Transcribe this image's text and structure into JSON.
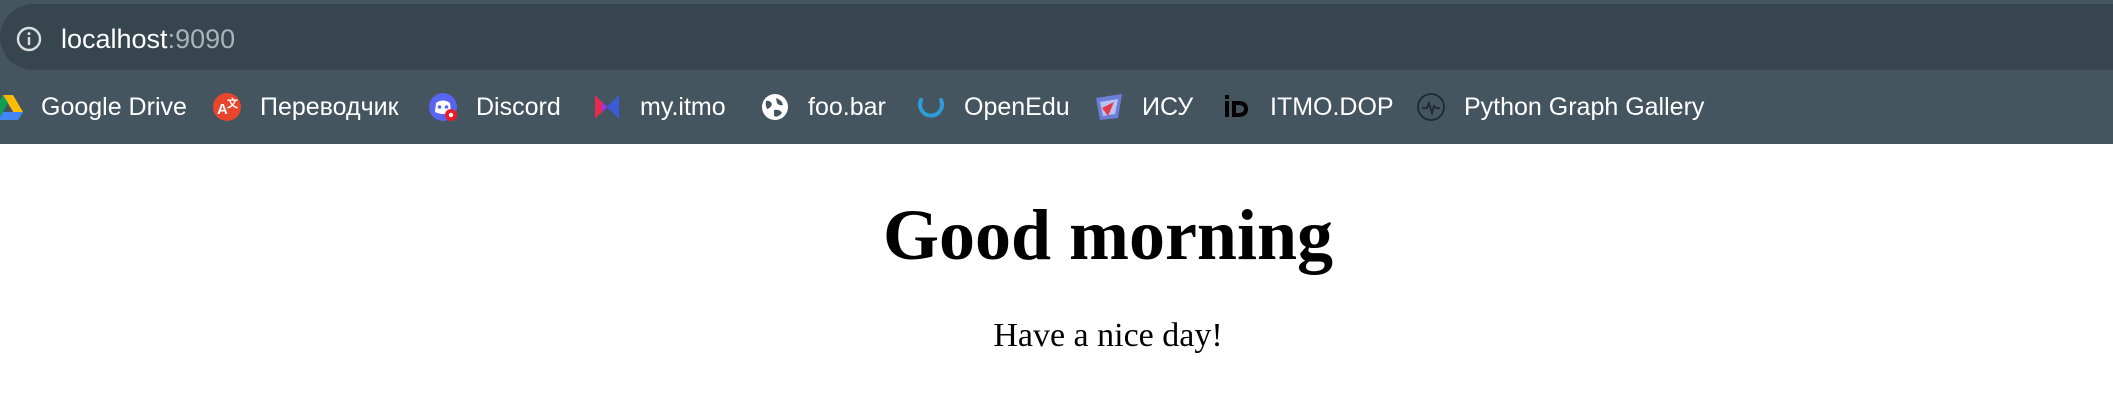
{
  "address_bar": {
    "host": "localhost",
    "port": ":9090",
    "icon": "info-icon"
  },
  "bookmarks": [
    {
      "label": "Google Drive",
      "icon": "google-drive-icon"
    },
    {
      "label": "Переводчик",
      "icon": "translator-icon"
    },
    {
      "label": "Discord",
      "icon": "discord-icon"
    },
    {
      "label": "my.itmo",
      "icon": "my-itmo-icon"
    },
    {
      "label": "foo.bar",
      "icon": "globe-icon"
    },
    {
      "label": "OpenEdu",
      "icon": "openedu-icon"
    },
    {
      "label": "ИСУ",
      "icon": "isu-icon"
    },
    {
      "label": "ITMO.DOP",
      "icon": "itmo-dop-icon"
    },
    {
      "label": "Python Graph Gallery",
      "icon": "python-graph-gallery-icon"
    }
  ],
  "page": {
    "heading": "Good morning",
    "subtext": "Have a nice day!"
  },
  "colors": {
    "toolbar": "#455560",
    "address_bar": "#37454e",
    "page_background": "#ffffff"
  }
}
